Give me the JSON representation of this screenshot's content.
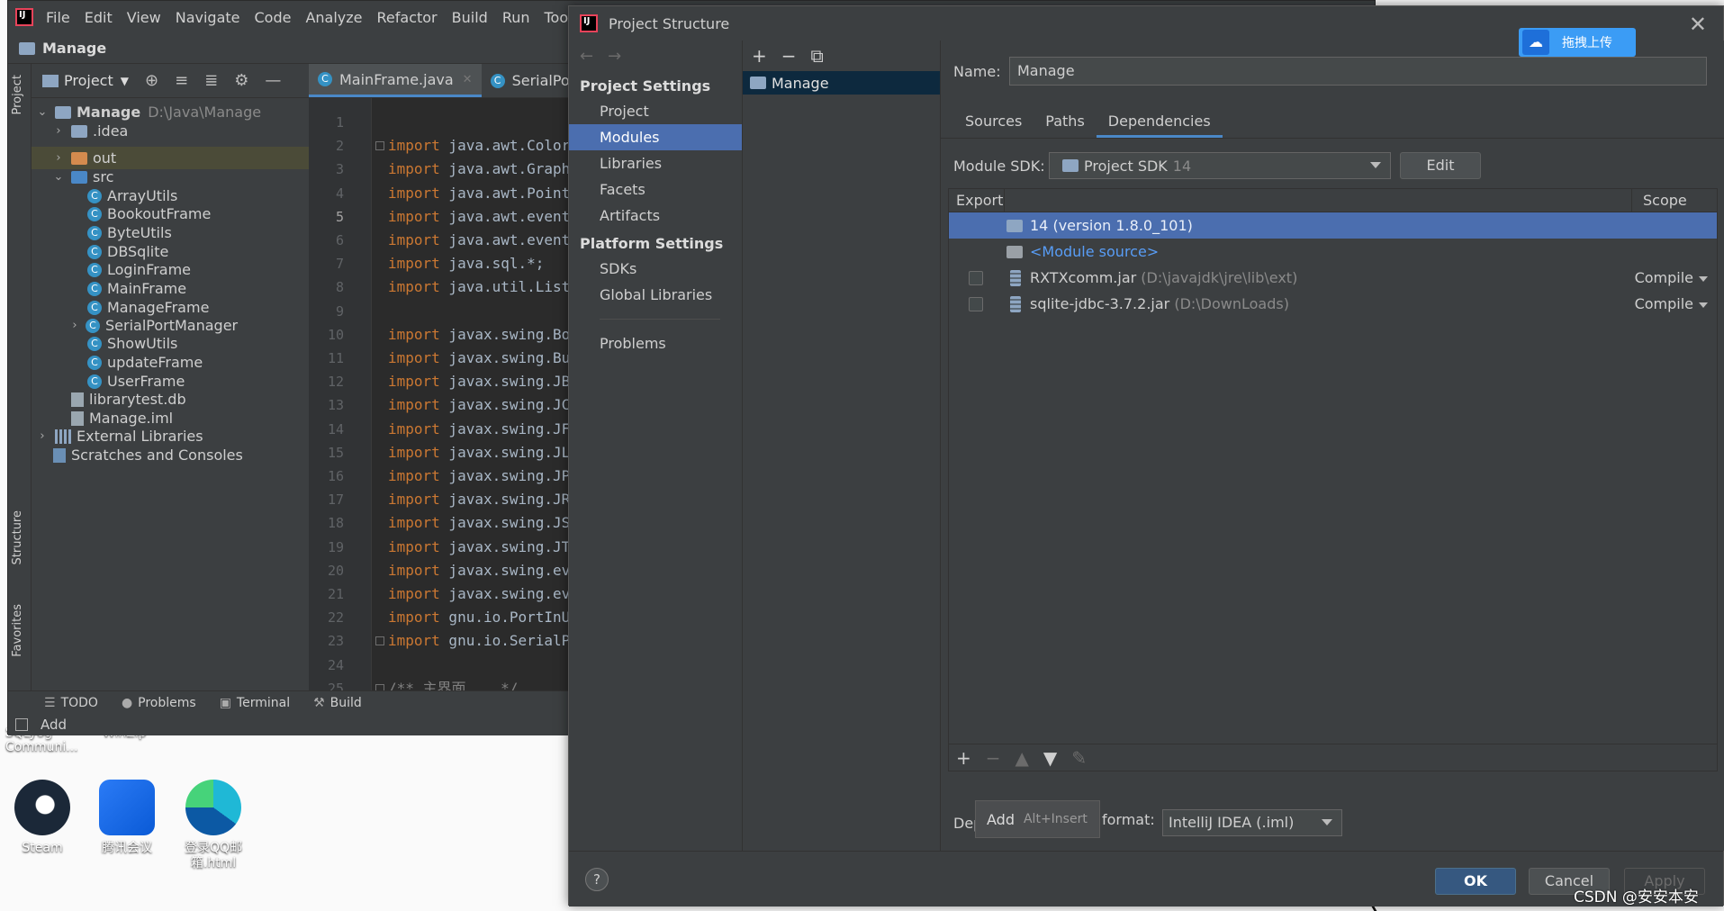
{
  "ide": {
    "menu": [
      "File",
      "Edit",
      "View",
      "Navigate",
      "Code",
      "Analyze",
      "Refactor",
      "Build",
      "Run",
      "Tools",
      "V"
    ],
    "breadcrumb": "Manage",
    "left_tools": {
      "project": "Project",
      "structure": "Structure",
      "favorites": "Favorites"
    },
    "project_panel_title": "Project",
    "tree": {
      "root": {
        "name": "Manage",
        "path": "D:\\Java\\Manage"
      },
      "idea": ".idea",
      "out": "out",
      "src": "src",
      "classes": [
        "ArrayUtils",
        "BookoutFrame",
        "ByteUtils",
        "DBSqlite",
        "LoginFrame",
        "MainFrame",
        "ManageFrame",
        "SerialPortManager",
        "ShowUtils",
        "updateFrame",
        "UserFrame"
      ],
      "class_glyph": "C",
      "db_file": "librarytest.db",
      "iml_file": "Manage.iml",
      "external_libs": "External Libraries",
      "scratches": "Scratches and Consoles"
    },
    "tabs": [
      {
        "label": "MainFrame.java",
        "active": true
      },
      {
        "label": "SerialPortM",
        "active": false
      }
    ],
    "code_lines": [
      {
        "n": "1",
        "kw": "",
        "rest": ""
      },
      {
        "n": "2",
        "kw": "import",
        "rest": " java.awt.Color"
      },
      {
        "n": "3",
        "kw": "import",
        "rest": " java.awt.Graph"
      },
      {
        "n": "4",
        "kw": "import",
        "rest": " java.awt.Point"
      },
      {
        "n": "5",
        "kw": "import",
        "rest": " java.awt.event"
      },
      {
        "n": "6",
        "kw": "import",
        "rest": " java.awt.event"
      },
      {
        "n": "7",
        "kw": "import",
        "rest": " java.sql.*;"
      },
      {
        "n": "8",
        "kw": "import",
        "rest": " java.util.List"
      },
      {
        "n": "9",
        "kw": "",
        "rest": ""
      },
      {
        "n": "10",
        "kw": "import",
        "rest": " javax.swing.Bo"
      },
      {
        "n": "11",
        "kw": "import",
        "rest": " javax.swing.Bu"
      },
      {
        "n": "12",
        "kw": "import",
        "rest": " javax.swing.JB"
      },
      {
        "n": "13",
        "kw": "import",
        "rest": " javax.swing.JC"
      },
      {
        "n": "14",
        "kw": "import",
        "rest": " javax.swing.JF"
      },
      {
        "n": "15",
        "kw": "import",
        "rest": " javax.swing.JL"
      },
      {
        "n": "16",
        "kw": "import",
        "rest": " javax.swing.JP"
      },
      {
        "n": "17",
        "kw": "import",
        "rest": " javax.swing.JR"
      },
      {
        "n": "18",
        "kw": "import",
        "rest": " javax.swing.JS"
      },
      {
        "n": "19",
        "kw": "import",
        "rest": " javax.swing.JT"
      },
      {
        "n": "20",
        "kw": "import",
        "rest": " javax.swing.ev"
      },
      {
        "n": "21",
        "kw": "import",
        "rest": " javax.swing.ev"
      },
      {
        "n": "22",
        "kw": "import",
        "rest": " gnu.io.PortInU"
      },
      {
        "n": "23",
        "kw": "import",
        "rest": " gnu.io.SerialP"
      },
      {
        "n": "24",
        "kw": "",
        "rest": ""
      },
      {
        "n": "25",
        "kw": "",
        "rest": "/** 主界面 ...*/"
      }
    ],
    "bottom_tools": [
      "TODO",
      "Problems",
      "Terminal",
      "Build"
    ],
    "status": "Add"
  },
  "desktop": {
    "partial_labels": [
      "SQLyog Communi...",
      "WinZip"
    ],
    "icons": [
      "Steam",
      "腾讯会议",
      "登录QQ邮箱.html"
    ]
  },
  "dialog": {
    "title": "Project Structure",
    "close_glyph": "✕",
    "nav": {
      "project_settings": "Project Settings",
      "project_items": [
        "Project",
        "Modules",
        "Libraries",
        "Facets",
        "Artifacts"
      ],
      "selected": "Modules",
      "platform_settings": "Platform Settings",
      "platform_items": [
        "SDKs",
        "Global Libraries"
      ],
      "problems": "Problems"
    },
    "module_toolbar": [
      "+",
      "−",
      "⧉"
    ],
    "module": "Manage",
    "name_label": "Name:",
    "name_value": "Manage",
    "upload_label": "拖拽上传",
    "tabs": [
      "Sources",
      "Paths",
      "Dependencies"
    ],
    "active_tab": "Dependencies",
    "sdk_label": "Module SDK:",
    "sdk_value": "Project SDK",
    "sdk_version": "14",
    "edit_label": "Edit",
    "table": {
      "col_export": "Export",
      "col_scope": "Scope",
      "rows": [
        {
          "name": "14 (version 1.8.0_101)",
          "path": "",
          "scope": "",
          "selected": true
        },
        {
          "name": "<Module source>",
          "path": "",
          "scope": "",
          "selected": false
        },
        {
          "name": "RXTXcomm.jar",
          "path": "(D:\\javajdk\\jre\\lib\\ext)",
          "scope": "Compile",
          "selected": false
        },
        {
          "name": "sqlite-jdbc-3.7.2.jar",
          "path": "(D:\\DownLoads)",
          "scope": "Compile",
          "selected": false
        }
      ]
    },
    "table_toolbar": [
      "+",
      "−",
      "▲",
      "▼",
      "✎"
    ],
    "dep_label": "Dep",
    "tooltip": {
      "label": "Add",
      "shortcut": "Alt+Insert"
    },
    "format_label": "format:",
    "format_value": "IntelliJ IDEA (.iml)",
    "help": "?",
    "ok": "OK",
    "cancel": "Cancel",
    "apply": "Apply"
  },
  "watermark": "CSDN @安安本安"
}
